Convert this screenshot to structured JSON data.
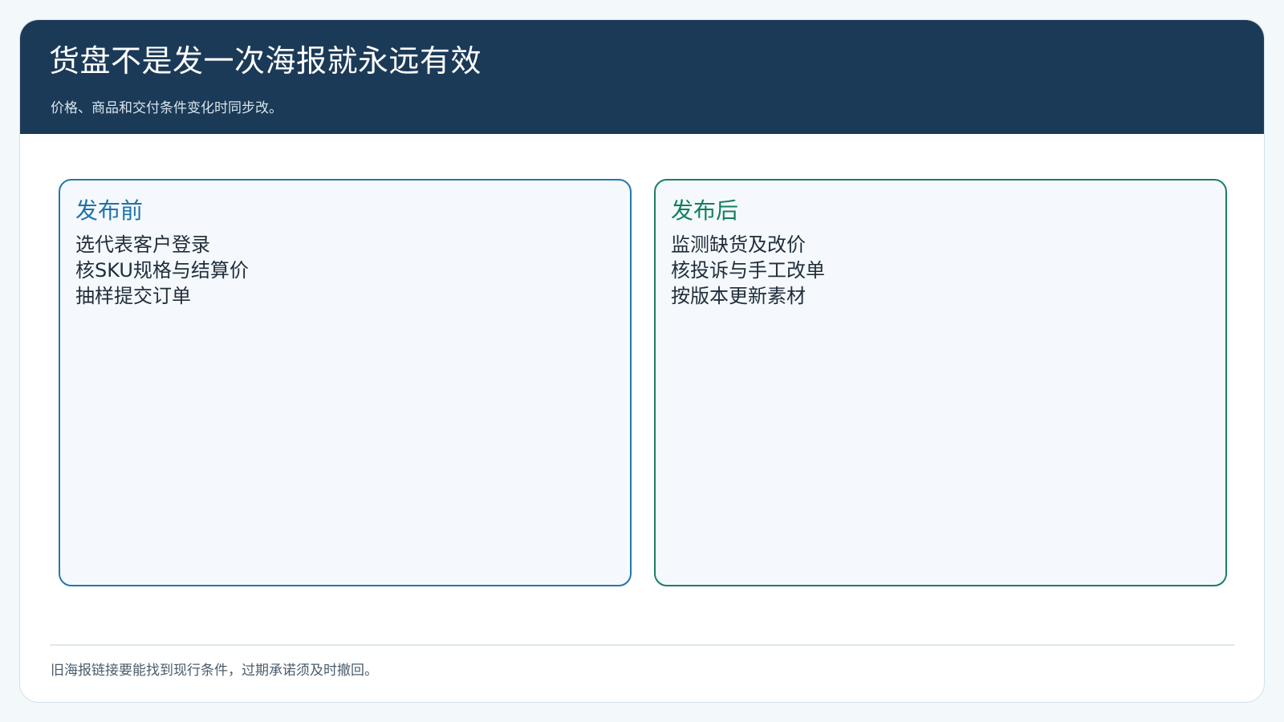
{
  "header": {
    "title": "货盘不是发一次海报就永远有效",
    "subtitle": "价格、商品和交付条件变化时同步改。"
  },
  "panels": {
    "before": {
      "title": "发布前",
      "items": [
        "选代表客户登录",
        "核SKU规格与结算价",
        "抽样提交订单"
      ],
      "accent": "#2477ad"
    },
    "after": {
      "title": "发布后",
      "items": [
        "监测缺货及改价",
        "核投诉与手工改单",
        "按版本更新素材"
      ],
      "accent": "#1a7f62"
    }
  },
  "footer": {
    "note": "旧海报链接要能找到现行条件，过期承诺须及时撤回。"
  },
  "colors": {
    "header_bg": "#1b3a57",
    "page_bg": "#f3f8fb"
  }
}
